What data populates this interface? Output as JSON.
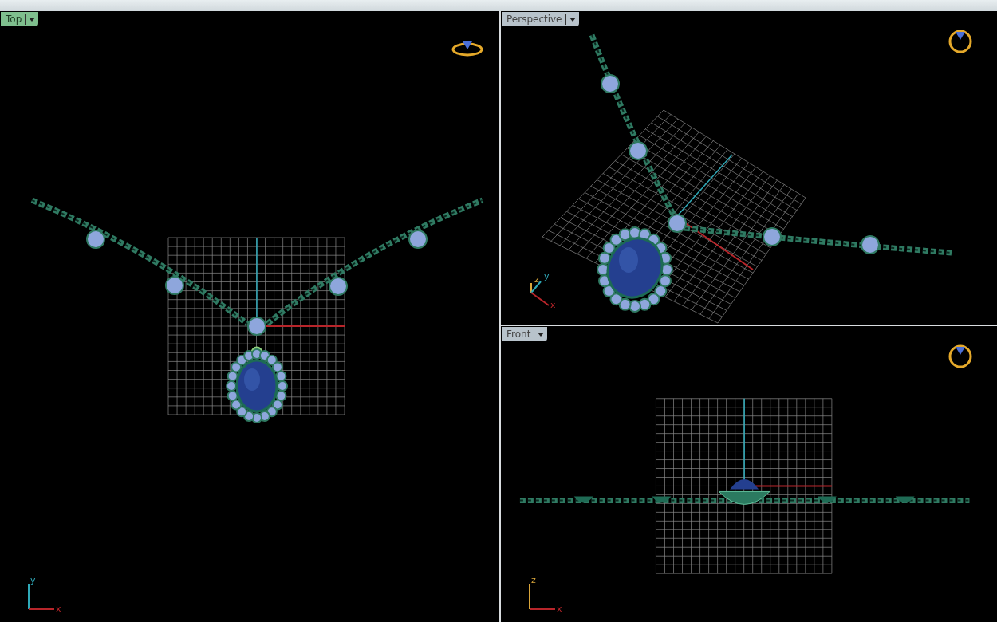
{
  "viewports": [
    {
      "name": "Top",
      "selected": true,
      "kind": "top",
      "axes": [
        "y",
        "x"
      ]
    },
    {
      "name": "Perspective",
      "selected": false,
      "kind": "perspective",
      "axes": [
        "z",
        "y",
        "x"
      ]
    },
    {
      "name": "Front",
      "selected": false,
      "kind": "front",
      "axes": [
        "z",
        "x"
      ]
    }
  ]
}
